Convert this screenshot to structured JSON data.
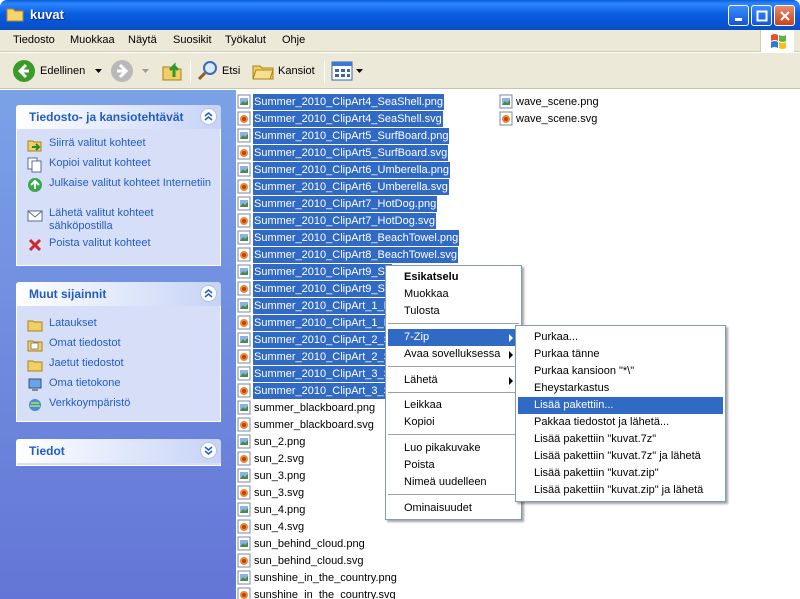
{
  "window": {
    "title": "kuvat"
  },
  "menubar": [
    "Tiedosto",
    "Muokkaa",
    "Näytä",
    "Suosikit",
    "Työkalut",
    "Ohje"
  ],
  "toolbar": {
    "back": "Edellinen",
    "search": "Etsi",
    "folders": "Kansiot"
  },
  "sidebar": {
    "tasks": {
      "title": "Tiedosto- ja kansiotehtävät",
      "items": [
        "Siirrä valitut kohteet",
        "Kopioi valitut kohteet",
        "Julkaise valitut kohteet Internetiin",
        "Lähetä valitut kohteet sähköpostilla",
        "Poista valitut kohteet"
      ]
    },
    "places": {
      "title": "Muut sijainnit",
      "items": [
        "Lataukset",
        "Omat tiedostot",
        "Jaetut tiedostot",
        "Oma tietokone",
        "Verkkoympäristö"
      ]
    },
    "details": {
      "title": "Tiedot"
    }
  },
  "files_col1": [
    {
      "name": "Summer_2010_ClipArt4_SeaShell.png",
      "type": "png",
      "selected": true
    },
    {
      "name": "Summer_2010_ClipArt4_SeaShell.svg",
      "type": "svg",
      "selected": true
    },
    {
      "name": "Summer_2010_ClipArt5_SurfBoard.png",
      "type": "png",
      "selected": true
    },
    {
      "name": "Summer_2010_ClipArt5_SurfBoard.svg",
      "type": "svg",
      "selected": true
    },
    {
      "name": "Summer_2010_ClipArt6_Umberella.png",
      "type": "png",
      "selected": true
    },
    {
      "name": "Summer_2010_ClipArt6_Umberella.svg",
      "type": "svg",
      "selected": true
    },
    {
      "name": "Summer_2010_ClipArt7_HotDog.png",
      "type": "png",
      "selected": true
    },
    {
      "name": "Summer_2010_ClipArt7_HotDog.svg",
      "type": "svg",
      "selected": true
    },
    {
      "name": "Summer_2010_ClipArt8_BeachTowel.png",
      "type": "png",
      "selected": true
    },
    {
      "name": "Summer_2010_ClipArt8_BeachTowel.svg",
      "type": "svg",
      "selected": true
    },
    {
      "name": "Summer_2010_ClipArt9_Su",
      "type": "png",
      "selected": true
    },
    {
      "name": "Summer_2010_ClipArt9_Su",
      "type": "svg",
      "selected": true
    },
    {
      "name": "Summer_2010_ClipArt_1_P",
      "type": "png",
      "selected": true
    },
    {
      "name": "Summer_2010_ClipArt_1_P",
      "type": "svg",
      "selected": true
    },
    {
      "name": "Summer_2010_ClipArt_2_Sl",
      "type": "png",
      "selected": true
    },
    {
      "name": "Summer_2010_ClipArt_2_Sl",
      "type": "svg",
      "selected": true
    },
    {
      "name": "Summer_2010_ClipArt_3_Sa",
      "type": "png",
      "selected": true
    },
    {
      "name": "Summer_2010_ClipArt_3_Sa",
      "type": "svg",
      "selected": true
    },
    {
      "name": "summer_blackboard.png",
      "type": "png",
      "selected": false
    },
    {
      "name": "summer_blackboard.svg",
      "type": "svg",
      "selected": false
    },
    {
      "name": "sun_2.png",
      "type": "png",
      "selected": false
    },
    {
      "name": "sun_2.svg",
      "type": "svg",
      "selected": false
    },
    {
      "name": "sun_3.png",
      "type": "png",
      "selected": false
    },
    {
      "name": "sun_3.svg",
      "type": "svg",
      "selected": false
    },
    {
      "name": "sun_4.png",
      "type": "png",
      "selected": false
    },
    {
      "name": "sun_4.svg",
      "type": "svg",
      "selected": false
    },
    {
      "name": "sun_behind_cloud.png",
      "type": "png",
      "selected": false
    },
    {
      "name": "sun_behind_cloud.svg",
      "type": "svg",
      "selected": false
    },
    {
      "name": "sunshine_in_the_country.png",
      "type": "png",
      "selected": false
    },
    {
      "name": "sunshine_in_the_country.svg",
      "type": "svg",
      "selected": false
    }
  ],
  "files_col2": [
    {
      "name": "wave_scene.png",
      "type": "png",
      "selected": false
    },
    {
      "name": "wave_scene.svg",
      "type": "svg",
      "selected": false
    }
  ],
  "context_menu": {
    "items": [
      "Esikatselu",
      "Muokkaa",
      "Tulosta",
      "7-Zip",
      "Avaa sovelluksessa",
      "Lähetä",
      "Leikkaa",
      "Kopioi",
      "Luo pikakuvake",
      "Poista",
      "Nimeä uudelleen",
      "Ominaisuudet"
    ]
  },
  "zip_menu": {
    "items": [
      "Purkaa...",
      "Purkaa tänne",
      "Purkaa kansioon \"*\\\"",
      "Eheystarkastus",
      "Lisää pakettiin...",
      "Pakkaa tiedostot ja lähetä...",
      "Lisää pakettiin \"kuvat.7z\"",
      "Lisää pakettiin \"kuvat.7z\" ja lähetä",
      "Lisää pakettiin \"kuvat.zip\"",
      "Lisää pakettiin \"kuvat.zip\" ja lähetä"
    ]
  },
  "colors": {
    "selection": "#316ac5",
    "title_blue": "#0a5fd8",
    "sidebar_link": "#215dc6"
  }
}
